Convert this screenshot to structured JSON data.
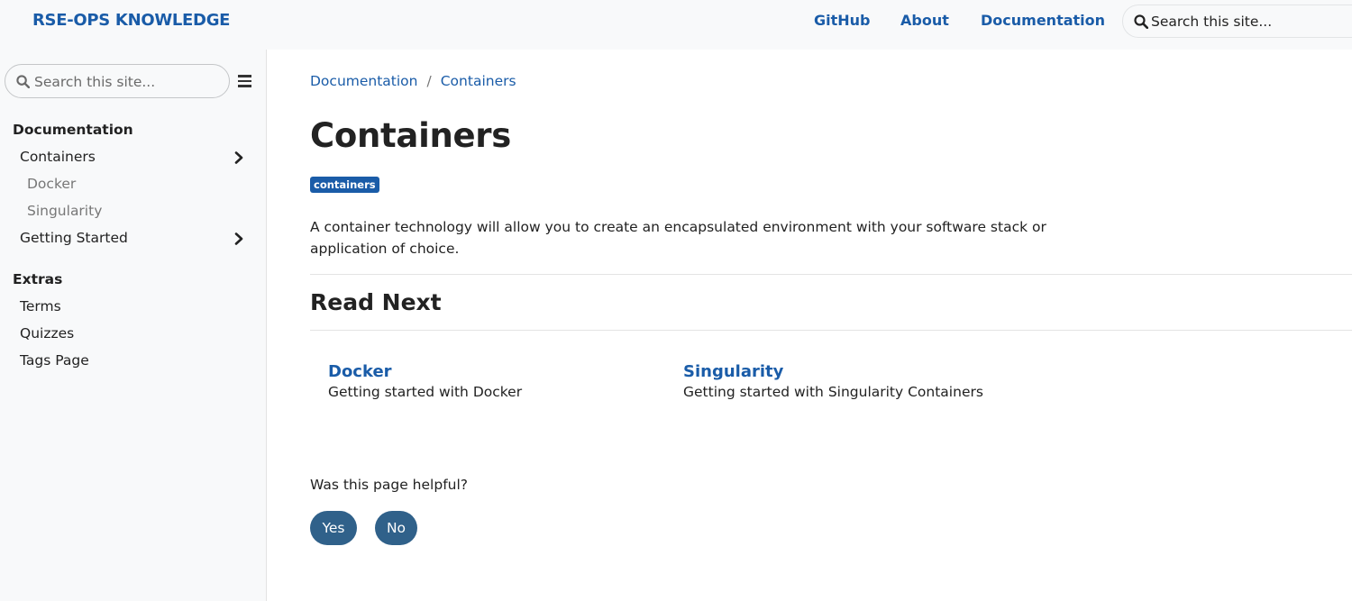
{
  "header": {
    "brand": "RSE-OPS KNOWLEDGE",
    "nav": [
      {
        "label": "GitHub"
      },
      {
        "label": "About"
      },
      {
        "label": "Documentation"
      }
    ],
    "search_placeholder": "Search this site...",
    "search_icon": "search-icon"
  },
  "sidebar": {
    "search_placeholder": "Search this site...",
    "menu_icon": "hamburger-icon",
    "sections": [
      {
        "title": "Documentation",
        "items": [
          {
            "label": "Containers",
            "chevron": "chevron-right-icon",
            "children": [
              {
                "label": "Docker"
              },
              {
                "label": "Singularity"
              }
            ]
          },
          {
            "label": "Getting Started",
            "chevron": "chevron-right-icon"
          }
        ]
      },
      {
        "title": "Extras",
        "items": [
          {
            "label": "Terms"
          },
          {
            "label": "Quizzes"
          },
          {
            "label": "Tags Page"
          }
        ]
      }
    ]
  },
  "main": {
    "breadcrumb": [
      {
        "label": "Documentation"
      },
      {
        "label": "Containers"
      }
    ],
    "breadcrumb_separator": "/",
    "title": "Containers",
    "tag": "containers",
    "lead": "A container technology will allow you to create an encapsulated environment with your software stack or application of choice.",
    "read_next_heading": "Read Next",
    "cards": [
      {
        "title": "Docker",
        "description": "Getting started with Docker"
      },
      {
        "title": "Singularity",
        "description": "Getting started with Singularity Containers"
      }
    ],
    "feedback": {
      "question": "Was this page helpful?",
      "yes": "Yes",
      "no": "No"
    }
  },
  "colors": {
    "link": "#1a5ca8",
    "button": "#30618a",
    "sidebar_bg": "#f8f9fa"
  }
}
